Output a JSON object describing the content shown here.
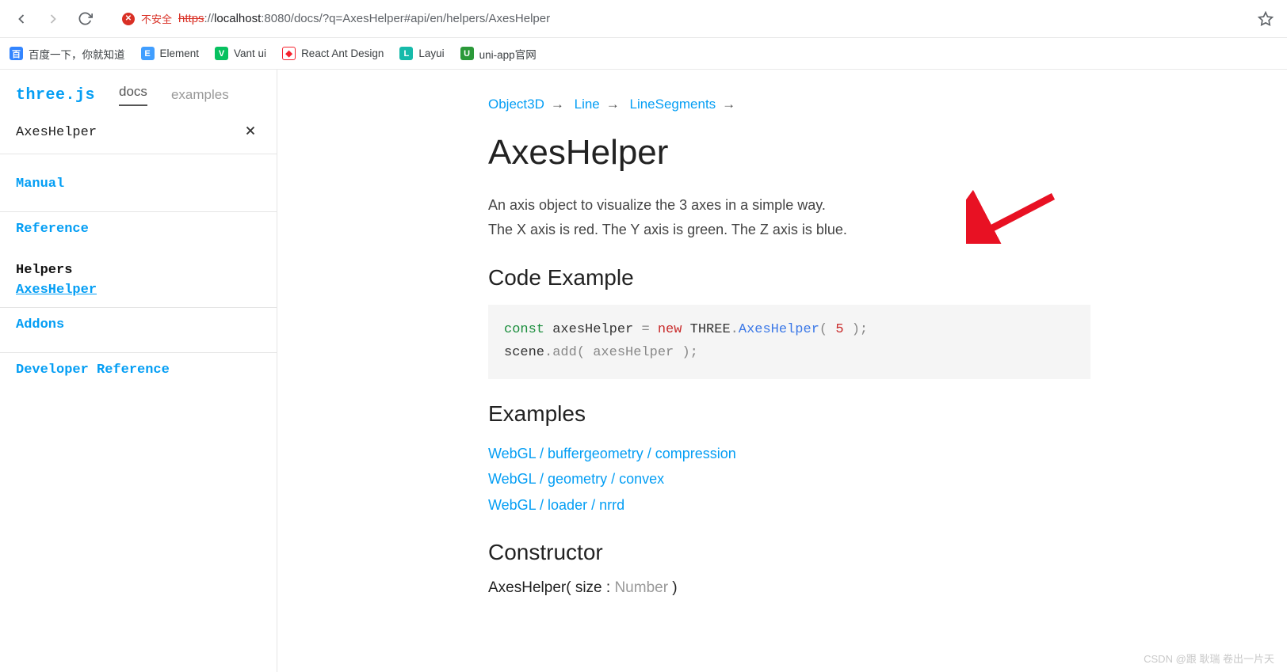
{
  "browser": {
    "warn_label": "不安全",
    "url_proto": "https",
    "url_host": "localhost",
    "url_rest": ":8080/docs/?q=AxesHelper#api/en/helpers/AxesHelper"
  },
  "bookmarks": [
    {
      "label": "百度一下，你就知道",
      "color": "#3385ff",
      "glyph": "百"
    },
    {
      "label": "Element",
      "color": "#409eff",
      "glyph": "E"
    },
    {
      "label": "Vant ui",
      "color": "#07c160",
      "glyph": "V"
    },
    {
      "label": "React Ant Design",
      "color": "#f5222d",
      "glyph": "◆"
    },
    {
      "label": "Layui",
      "color": "#16baaa",
      "glyph": "L"
    },
    {
      "label": "uni-app官网",
      "color": "#2b9939",
      "glyph": "U"
    }
  ],
  "sidebar": {
    "logo": "three.js",
    "tabs": {
      "docs": "docs",
      "examples": "examples"
    },
    "search_value": "AxesHelper",
    "nav": {
      "manual": "Manual",
      "reference": "Reference",
      "helpers_head": "Helpers",
      "helpers_item": "AxesHelper",
      "addons": "Addons",
      "devref": "Developer Reference"
    }
  },
  "content": {
    "breadcrumb": [
      "Object3D",
      "Line",
      "LineSegments"
    ],
    "title": "AxesHelper",
    "desc_l1": "An axis object to visualize the 3 axes in a simple way.",
    "desc_l2": "The X axis is red. The Y axis is green. The Z axis is blue.",
    "code_heading": "Code Example",
    "code": {
      "const": "const",
      "var1": " axesHelper ",
      "eq": "= ",
      "new": "new",
      "three": " THREE",
      "dot": ".",
      "cls": "AxesHelper",
      "open": "( ",
      "num": "5",
      "close": " );",
      "line2a": "scene",
      "line2b": ".add( axesHelper );"
    },
    "examples_heading": "Examples",
    "examples": [
      "WebGL / buffergeometry / compression",
      "WebGL / geometry / convex",
      "WebGL / loader / nrrd"
    ],
    "constructor_heading": "Constructor",
    "constructor_sig_a": "AxesHelper( size : ",
    "constructor_sig_type": "Number",
    "constructor_sig_b": " )"
  },
  "watermark": "CSDN @跟 耿瑞 卷出一片天"
}
